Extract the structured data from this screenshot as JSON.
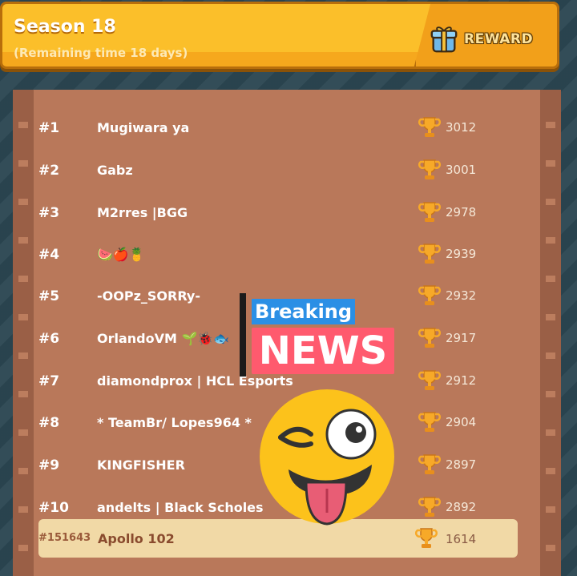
{
  "header": {
    "title": "Season 18",
    "subtitle": "(Remaining time 18 days)",
    "reward_label": "REWARD",
    "reward_icon": "gift-icon"
  },
  "leaderboard": [
    {
      "rank": "#1",
      "name": "Mugiwara ya",
      "score": "3012"
    },
    {
      "rank": "#2",
      "name": "Gabz",
      "score": "3001"
    },
    {
      "rank": "#3",
      "name": "M2rres |BGG",
      "score": "2978"
    },
    {
      "rank": "#4",
      "name": "🍉🍎🍍",
      "score": "2939"
    },
    {
      "rank": "#5",
      "name": "-OOPz_SORRy-",
      "score": "2932"
    },
    {
      "rank": "#6",
      "name": "OrlandoVM 🌱🐞🐟",
      "score": "2917"
    },
    {
      "rank": "#7",
      "name": "diamondprox | HCL Esports",
      "score": "2912"
    },
    {
      "rank": "#8",
      "name": "* TeamBr/ Lopes964 *",
      "score": "2904"
    },
    {
      "rank": "#9",
      "name": "KINGFISHER",
      "score": "2897"
    },
    {
      "rank": "#10",
      "name": "andelts | Black Scholes",
      "score": "2892"
    }
  ],
  "current_player": {
    "rank": "#151643",
    "name": "Apollo 102",
    "score": "1614"
  },
  "overlay": {
    "breaking": "Breaking",
    "news": "NEWS",
    "emoji_icon": "winking-tongue-emoji-icon"
  },
  "colors": {
    "header": "#fbbf2a",
    "board": "#b9785a",
    "highlight_row": "#f1d9a6",
    "breaking_blue": "#2b8fe5",
    "news_pink": "#ff5a6e"
  }
}
